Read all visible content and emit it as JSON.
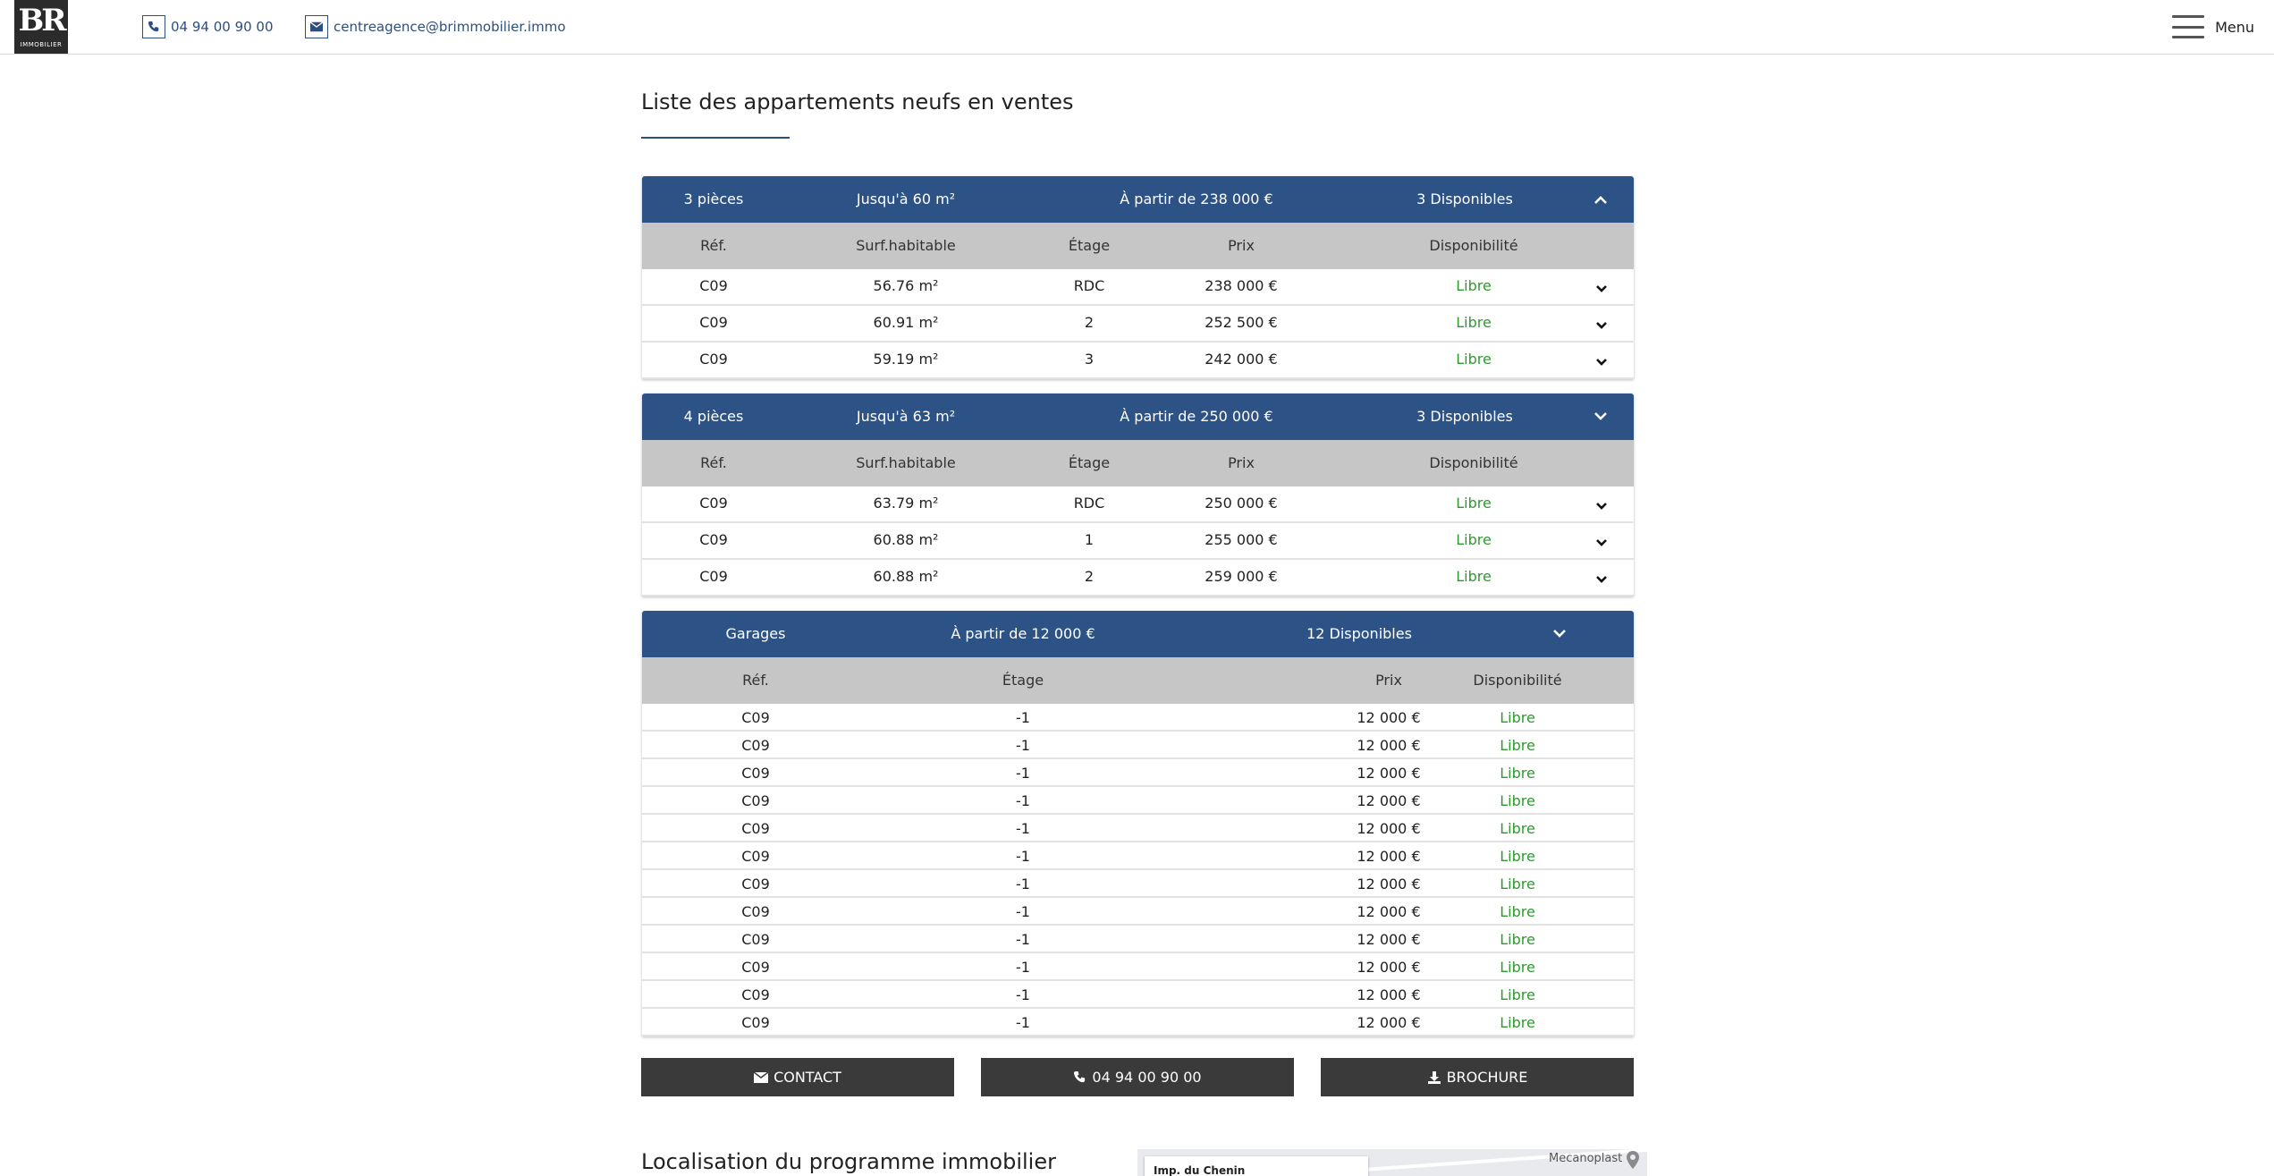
{
  "header": {
    "logo_mark": "BR",
    "logo_sub": "IMMOBILIER",
    "phone": "04 94 00 90 00",
    "email": "centreagence@brimmobilier.immo",
    "menu_label": "Menu"
  },
  "page_title": "Liste des appartements neufs en ventes",
  "apartment_columns": {
    "ref": "Réf.",
    "surface": "Surf.habitable",
    "floor": "Étage",
    "price": "Prix",
    "availability": "Disponibilité"
  },
  "groups": [
    {
      "name": "3 pièces",
      "surface": "Jusqu'à 60 m²",
      "price_from": "À partir de 238 000 €",
      "available": "3 Disponibles",
      "rows": [
        {
          "ref": "C09",
          "surface": "56.76 m²",
          "floor": "RDC",
          "price": "238 000 €",
          "status": "Libre"
        },
        {
          "ref": "C09",
          "surface": "60.91 m²",
          "floor": "2",
          "price": "252 500 €",
          "status": "Libre"
        },
        {
          "ref": "C09",
          "surface": "59.19 m²",
          "floor": "3",
          "price": "242 000 €",
          "status": "Libre"
        }
      ]
    },
    {
      "name": "4 pièces",
      "surface": "Jusqu'à 63 m²",
      "price_from": "À partir de 250 000 €",
      "available": "3 Disponibles",
      "rows": [
        {
          "ref": "C09",
          "surface": "63.79 m²",
          "floor": "RDC",
          "price": "250 000 €",
          "status": "Libre"
        },
        {
          "ref": "C09",
          "surface": "60.88 m²",
          "floor": "1",
          "price": "255 000 €",
          "status": "Libre"
        },
        {
          "ref": "C09",
          "surface": "60.88 m²",
          "floor": "2",
          "price": "259 000 €",
          "status": "Libre"
        }
      ]
    }
  ],
  "garages": {
    "name": "Garages",
    "price_from": "À partir de 12 000 €",
    "available": "12 Disponibles",
    "columns": {
      "ref": "Réf.",
      "floor": "Étage",
      "price": "Prix",
      "availability": "Disponibilité"
    },
    "rows": [
      {
        "ref": "C09",
        "floor": "-1",
        "price": "12 000 €",
        "status": "Libre"
      },
      {
        "ref": "C09",
        "floor": "-1",
        "price": "12 000 €",
        "status": "Libre"
      },
      {
        "ref": "C09",
        "floor": "-1",
        "price": "12 000 €",
        "status": "Libre"
      },
      {
        "ref": "C09",
        "floor": "-1",
        "price": "12 000 €",
        "status": "Libre"
      },
      {
        "ref": "C09",
        "floor": "-1",
        "price": "12 000 €",
        "status": "Libre"
      },
      {
        "ref": "C09",
        "floor": "-1",
        "price": "12 000 €",
        "status": "Libre"
      },
      {
        "ref": "C09",
        "floor": "-1",
        "price": "12 000 €",
        "status": "Libre"
      },
      {
        "ref": "C09",
        "floor": "-1",
        "price": "12 000 €",
        "status": "Libre"
      },
      {
        "ref": "C09",
        "floor": "-1",
        "price": "12 000 €",
        "status": "Libre"
      },
      {
        "ref": "C09",
        "floor": "-1",
        "price": "12 000 €",
        "status": "Libre"
      },
      {
        "ref": "C09",
        "floor": "-1",
        "price": "12 000 €",
        "status": "Libre"
      },
      {
        "ref": "C09",
        "floor": "-1",
        "price": "12 000 €",
        "status": "Libre"
      }
    ]
  },
  "buttons": {
    "contact": "CONTACT",
    "phone": "04 94 00 90 00",
    "brochure": "BROCHURE"
  },
  "location": {
    "title": "Localisation du programme immobilier",
    "map_card": "Imp. du Chenin",
    "map_place": "Mecanoplast"
  },
  "colors": {
    "primary": "#2d5286",
    "header_row": "#c6c6c6",
    "available": "#2e9a2e",
    "button": "#3a3a3a"
  }
}
